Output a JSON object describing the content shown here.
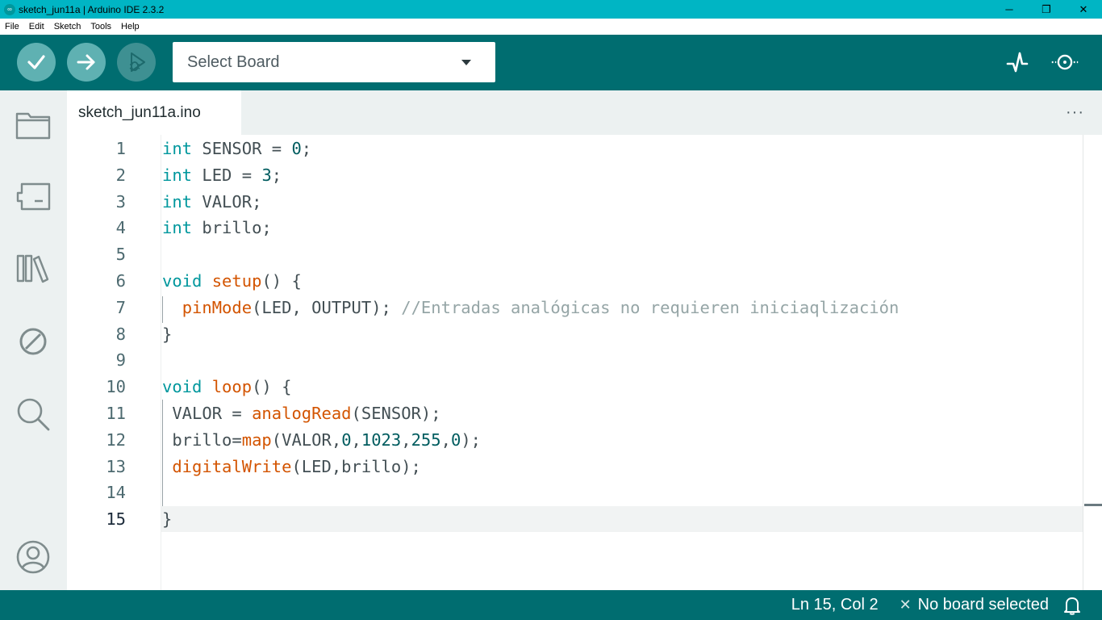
{
  "window": {
    "title": "sketch_jun11a | Arduino IDE 2.3.2",
    "controls": {
      "minimize": "─",
      "maximize": "❐",
      "close": "✕"
    }
  },
  "menu": [
    "File",
    "Edit",
    "Sketch",
    "Tools",
    "Help"
  ],
  "toolbar": {
    "board_select": "Select Board",
    "buttons": [
      "verify-icon",
      "upload-icon",
      "debug-icon",
      "serial-plotter-icon",
      "serial-monitor-icon"
    ]
  },
  "sidebar": {
    "items": [
      "folder-icon",
      "board-manager-icon",
      "library-icon",
      "debug-disabled-icon",
      "search-icon",
      "profile-icon"
    ]
  },
  "tabs": [
    {
      "label": "sketch_jun11a.ino",
      "active": true
    }
  ],
  "tab_more": "···",
  "editor": {
    "line_numbers": [
      "1",
      "2",
      "3",
      "4",
      "5",
      "6",
      "7",
      "8",
      "9",
      "10",
      "11",
      "12",
      "13",
      "14",
      "15"
    ],
    "current_line": "15",
    "lines": [
      [
        {
          "t": "kw",
          "v": "int"
        },
        {
          "t": "p",
          "v": " SENSOR = "
        },
        {
          "t": "num",
          "v": "0"
        },
        {
          "t": "p",
          "v": ";"
        }
      ],
      [
        {
          "t": "kw",
          "v": "int"
        },
        {
          "t": "p",
          "v": " LED = "
        },
        {
          "t": "num",
          "v": "3"
        },
        {
          "t": "p",
          "v": ";"
        }
      ],
      [
        {
          "t": "kw",
          "v": "int"
        },
        {
          "t": "p",
          "v": " VALOR;"
        }
      ],
      [
        {
          "t": "kw",
          "v": "int"
        },
        {
          "t": "p",
          "v": " brillo;"
        }
      ],
      [],
      [
        {
          "t": "kw",
          "v": "void"
        },
        {
          "t": "p",
          "v": " "
        },
        {
          "t": "fn",
          "v": "setup"
        },
        {
          "t": "p",
          "v": "() {"
        }
      ],
      [
        {
          "t": "p",
          "v": "  "
        },
        {
          "t": "fn",
          "v": "pinMode"
        },
        {
          "t": "p",
          "v": "(LED, OUTPUT); "
        },
        {
          "t": "cm",
          "v": "//Entradas analógicas no requieren iniciaqlización"
        }
      ],
      [
        {
          "t": "p",
          "v": "}"
        }
      ],
      [],
      [
        {
          "t": "kw",
          "v": "void"
        },
        {
          "t": "p",
          "v": " "
        },
        {
          "t": "fn",
          "v": "loop"
        },
        {
          "t": "p",
          "v": "() {"
        }
      ],
      [
        {
          "t": "p",
          "v": " VALOR = "
        },
        {
          "t": "fn",
          "v": "analogRead"
        },
        {
          "t": "p",
          "v": "(SENSOR);"
        }
      ],
      [
        {
          "t": "p",
          "v": " brillo="
        },
        {
          "t": "fn",
          "v": "map"
        },
        {
          "t": "p",
          "v": "(VALOR,"
        },
        {
          "t": "num",
          "v": "0"
        },
        {
          "t": "p",
          "v": ","
        },
        {
          "t": "num",
          "v": "1023"
        },
        {
          "t": "p",
          "v": ","
        },
        {
          "t": "num",
          "v": "255"
        },
        {
          "t": "p",
          "v": ","
        },
        {
          "t": "num",
          "v": "0"
        },
        {
          "t": "p",
          "v": ");"
        }
      ],
      [
        {
          "t": "p",
          "v": " "
        },
        {
          "t": "fn",
          "v": "digitalWrite"
        },
        {
          "t": "p",
          "v": "(LED,brillo);"
        }
      ],
      [],
      [
        {
          "t": "p",
          "v": "}"
        }
      ]
    ]
  },
  "status": {
    "position": "Ln 15, Col 2",
    "board": "No board selected",
    "x_glyph": "✕"
  },
  "colors": {
    "accent_teal": "#006d70",
    "titlebar": "#00b5c4",
    "keyword": "#00979d",
    "function": "#d35400",
    "comment": "#95a5a6"
  }
}
